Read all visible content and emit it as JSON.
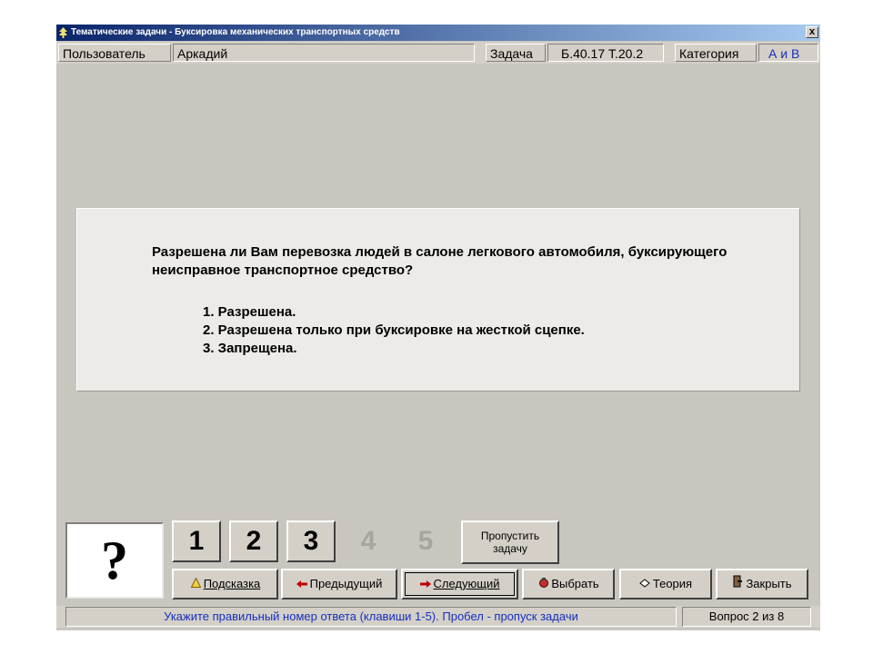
{
  "window": {
    "title": "Тематические задачи - Буксировка механических транспортных средств",
    "close_glyph": "x"
  },
  "infobar": {
    "user_label": "Пользователь",
    "user_value": "Аркадий",
    "task_label": "Задача",
    "task_value": "Б.40.17  Т.20.2",
    "category_label": "Категория",
    "category_value": "А и В",
    "category_color": "#1530c0"
  },
  "question": {
    "text": "Разрешена ли Вам перевозка людей в салоне легкового автомобиля, буксирующего неисправное транспортное средство?",
    "answers": [
      "1. Разрешена.",
      "2. Разрешена только при буксировке на жесткой сцепке.",
      "3. Запрещена."
    ]
  },
  "answer_indicator": "?",
  "number_buttons": [
    "1",
    "2",
    "3"
  ],
  "disabled_numbers": [
    "4",
    "5"
  ],
  "skip_button": {
    "line1": "Пропустить",
    "line2": "задачу"
  },
  "actions": {
    "hint": {
      "icon": "hint-icon",
      "label": "Подсказка"
    },
    "prev": {
      "icon": "arrow-left-icon",
      "label": "Предыдущий"
    },
    "next": {
      "icon": "arrow-right-icon",
      "label": "Следующий"
    },
    "choose": {
      "icon": "select-icon",
      "label": "Выбрать"
    },
    "theory": {
      "icon": "theory-icon",
      "label": "Теория"
    },
    "close": {
      "icon": "exit-icon",
      "label": "Закрыть"
    }
  },
  "status": {
    "hint": "Укажите правильный номер ответа (клавиши 1-5). Пробел - пропуск задачи",
    "counter": "Вопрос 2 из 8",
    "hint_color": "#1530c0"
  }
}
